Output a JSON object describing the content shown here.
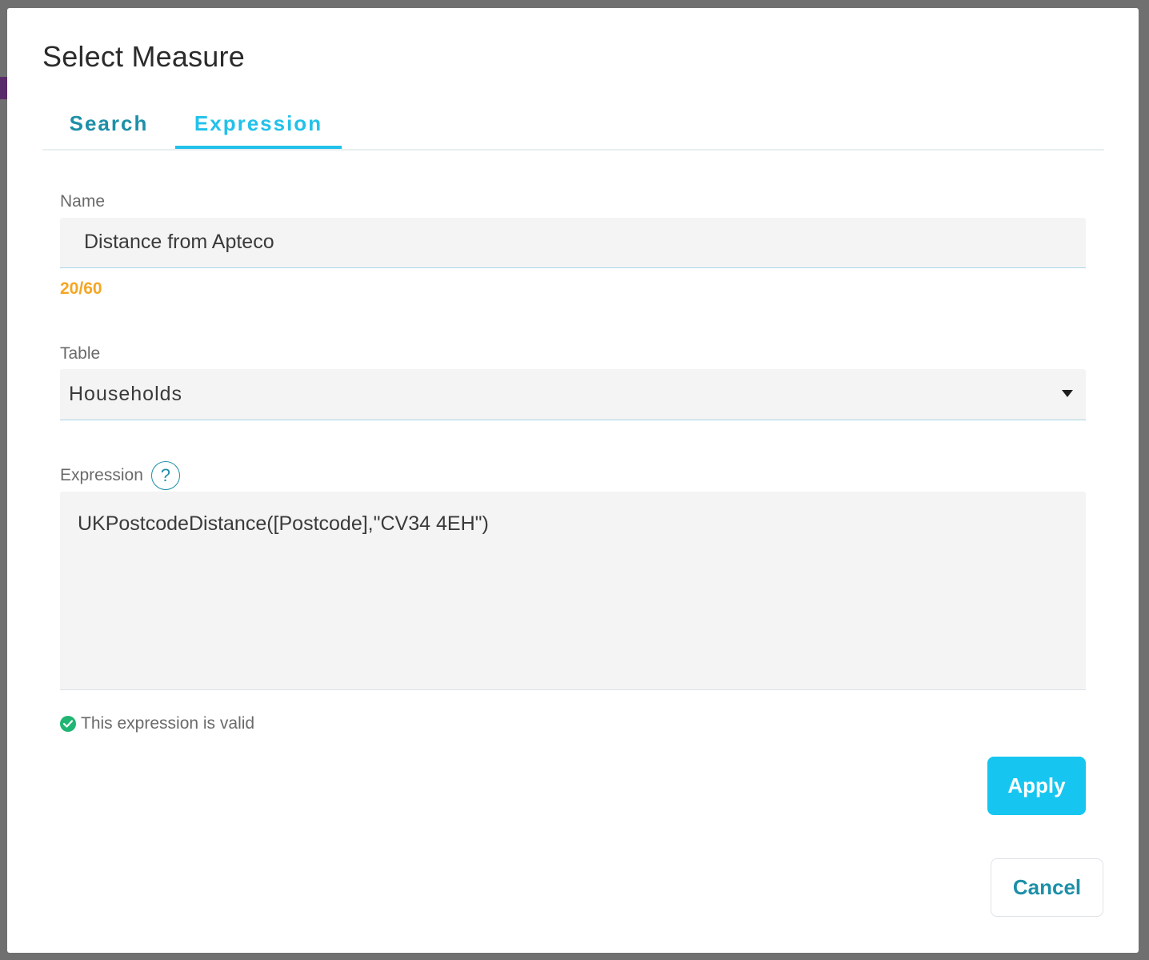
{
  "dialog": {
    "title": "Select Measure"
  },
  "tabs": [
    {
      "label": "Search",
      "active": false
    },
    {
      "label": "Expression",
      "active": true
    }
  ],
  "form": {
    "name": {
      "label": "Name",
      "value": "Distance from Apteco",
      "counter": "20/60"
    },
    "table": {
      "label": "Table",
      "selected": "Households",
      "icon": "caret-down-icon"
    },
    "expression": {
      "label": "Expression",
      "help_icon": "?",
      "value": "UKPostcodeDistance([Postcode],\"CV34 4EH\")",
      "validation": "This expression is valid"
    }
  },
  "buttons": {
    "apply": "Apply",
    "cancel": "Cancel"
  },
  "colors": {
    "accent": "#22c1ea",
    "tab_inactive": "#1d8fa8",
    "counter": "#f5a623",
    "valid": "#1fb573",
    "apply_bg": "#16c6f0"
  }
}
